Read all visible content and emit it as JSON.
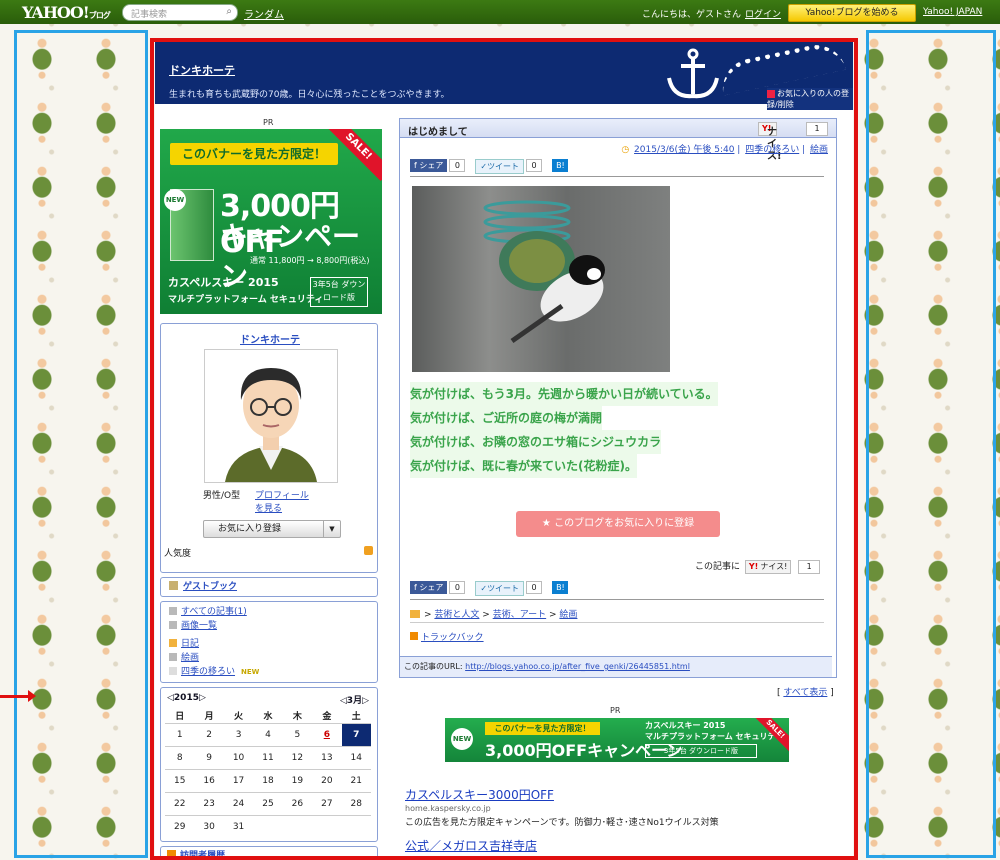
{
  "topbar": {
    "logo": "YAHOO!",
    "logo_sub": "ブログ",
    "logo_japan": "JAPAN",
    "search_placeholder": "記事検索",
    "random": "ランダム",
    "greeting": "こんにちは、ゲストさん",
    "login": "ログイン",
    "start_blog": "Yahoo!ブログを始める",
    "yahoo_japan": "Yahoo! JAPAN"
  },
  "header": {
    "blog_title": "ドンキホーテ",
    "description": "生まれも育ちも武蔵野の70歳。日々心に残ったことをつぶやきます。",
    "fav_link": "お気に入りの人の登録/削除"
  },
  "pr_label": "PR",
  "ad_banner": {
    "ribbon": "このバナーを見た方限定！",
    "sale": "SALE!",
    "headline": "3,000円OFF",
    "headline2": "キャンペーン",
    "price": "通常 11,800円 → 8,800円(税込)",
    "product": "カスペルスキー 2015",
    "product_sub": "マルチプラットフォーム セキュリティ",
    "box": "3年5台 ダウンロード版",
    "new": "NEW"
  },
  "profile": {
    "name": "ドンキホーテ",
    "gender": "男性/O型",
    "profile_link": "プロフィールを見る",
    "fav_button": "お気に入り登録",
    "popularity": "人気度"
  },
  "sidebar": {
    "guestbook": "ゲストブック",
    "all_articles": "すべての記事(1)",
    "image_list": "画像一覧",
    "categories": [
      "日記",
      "絵画",
      "四季の移ろい"
    ],
    "new_tag": "NEW",
    "visitors": "訪問者履歴"
  },
  "calendar": {
    "year_label": "◁2015▷",
    "month_label": "◁3月▷",
    "weekdays": [
      "日",
      "月",
      "火",
      "水",
      "木",
      "金",
      "土"
    ],
    "weeks": [
      [
        "1",
        "2",
        "3",
        "4",
        "5",
        "6",
        "7"
      ],
      [
        "8",
        "9",
        "10",
        "11",
        "12",
        "13",
        "14"
      ],
      [
        "15",
        "16",
        "17",
        "18",
        "19",
        "20",
        "21"
      ],
      [
        "22",
        "23",
        "24",
        "25",
        "26",
        "27",
        "28"
      ],
      [
        "29",
        "30",
        "31",
        "",
        "",
        "",
        ""
      ]
    ],
    "linked_day": "6",
    "today": "7"
  },
  "article": {
    "title": "はじめまして",
    "nice": "ナイス!",
    "nice_count": "1",
    "date": "2015/3/6(金) 午後 5:40",
    "category1": "四季の移ろい",
    "category2": "絵画",
    "share": "シェア",
    "share_count": "0",
    "tweet": "ツイート",
    "tweet_count": "0",
    "hatena": "B!",
    "lines": [
      "気が付けば、もう3月。先週から暖かい日が続いている。",
      "気が付けば、ご近所の庭の梅が満開",
      "気が付けば、お隣の窓のエサ箱にシジュウカラ",
      "気が付けば、既に春が来ていた(花粉症)。"
    ],
    "fav_blog_button": "このブログをお気に入りに登録",
    "kiji_label": "この記事に",
    "breadcrumb": [
      "芸術と人文",
      "芸術、アート",
      "絵画"
    ],
    "trackback": "トラックバック",
    "url_label": "この記事のURL:",
    "url": "http://blogs.yahoo.co.jp/after_five_genki/26445851.html"
  },
  "show_all": "すべて表示",
  "ad_small": {
    "ribbon": "このバナーを見た方限定！",
    "headline": "3,000円OFFキャンペーン",
    "product": "カスペルスキー 2015",
    "product_sub": "マルチプラットフォーム セキュリティ",
    "box": "3年5台 ダウンロード版",
    "sale": "SALE!",
    "new": "NEW"
  },
  "text_ads": [
    {
      "title": "カスペルスキー3000円OFF",
      "domain": "home.kaspersky.co.jp",
      "text": "この広告を見た方限定キャンペーンです。防御力･軽さ･速さNo1ウイルス対策"
    },
    {
      "title": "公式／メガロス吉祥寺店"
    }
  ],
  "colors": {
    "header_navy": "#0d2a72",
    "topbar_green": "#3c7a13",
    "red_frame": "#e01010",
    "blue_frame": "#2aa3e6",
    "body_text_green": "#3aa44b"
  }
}
